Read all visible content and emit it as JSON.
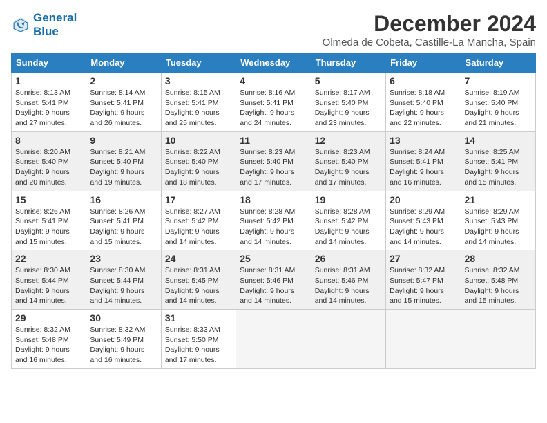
{
  "logo": {
    "line1": "General",
    "line2": "Blue"
  },
  "title": "December 2024",
  "subtitle": "Olmeda de Cobeta, Castille-La Mancha, Spain",
  "days_of_week": [
    "Sunday",
    "Monday",
    "Tuesday",
    "Wednesday",
    "Thursday",
    "Friday",
    "Saturday"
  ],
  "weeks": [
    [
      {
        "day": "1",
        "sunrise": "8:13 AM",
        "sunset": "5:41 PM",
        "daylight": "9 hours and 27 minutes."
      },
      {
        "day": "2",
        "sunrise": "8:14 AM",
        "sunset": "5:41 PM",
        "daylight": "9 hours and 26 minutes."
      },
      {
        "day": "3",
        "sunrise": "8:15 AM",
        "sunset": "5:41 PM",
        "daylight": "9 hours and 25 minutes."
      },
      {
        "day": "4",
        "sunrise": "8:16 AM",
        "sunset": "5:41 PM",
        "daylight": "9 hours and 24 minutes."
      },
      {
        "day": "5",
        "sunrise": "8:17 AM",
        "sunset": "5:40 PM",
        "daylight": "9 hours and 23 minutes."
      },
      {
        "day": "6",
        "sunrise": "8:18 AM",
        "sunset": "5:40 PM",
        "daylight": "9 hours and 22 minutes."
      },
      {
        "day": "7",
        "sunrise": "8:19 AM",
        "sunset": "5:40 PM",
        "daylight": "9 hours and 21 minutes."
      }
    ],
    [
      {
        "day": "8",
        "sunrise": "8:20 AM",
        "sunset": "5:40 PM",
        "daylight": "9 hours and 20 minutes."
      },
      {
        "day": "9",
        "sunrise": "8:21 AM",
        "sunset": "5:40 PM",
        "daylight": "9 hours and 19 minutes."
      },
      {
        "day": "10",
        "sunrise": "8:22 AM",
        "sunset": "5:40 PM",
        "daylight": "9 hours and 18 minutes."
      },
      {
        "day": "11",
        "sunrise": "8:23 AM",
        "sunset": "5:40 PM",
        "daylight": "9 hours and 17 minutes."
      },
      {
        "day": "12",
        "sunrise": "8:23 AM",
        "sunset": "5:40 PM",
        "daylight": "9 hours and 17 minutes."
      },
      {
        "day": "13",
        "sunrise": "8:24 AM",
        "sunset": "5:41 PM",
        "daylight": "9 hours and 16 minutes."
      },
      {
        "day": "14",
        "sunrise": "8:25 AM",
        "sunset": "5:41 PM",
        "daylight": "9 hours and 15 minutes."
      }
    ],
    [
      {
        "day": "15",
        "sunrise": "8:26 AM",
        "sunset": "5:41 PM",
        "daylight": "9 hours and 15 minutes."
      },
      {
        "day": "16",
        "sunrise": "8:26 AM",
        "sunset": "5:41 PM",
        "daylight": "9 hours and 15 minutes."
      },
      {
        "day": "17",
        "sunrise": "8:27 AM",
        "sunset": "5:42 PM",
        "daylight": "9 hours and 14 minutes."
      },
      {
        "day": "18",
        "sunrise": "8:28 AM",
        "sunset": "5:42 PM",
        "daylight": "9 hours and 14 minutes."
      },
      {
        "day": "19",
        "sunrise": "8:28 AM",
        "sunset": "5:42 PM",
        "daylight": "9 hours and 14 minutes."
      },
      {
        "day": "20",
        "sunrise": "8:29 AM",
        "sunset": "5:43 PM",
        "daylight": "9 hours and 14 minutes."
      },
      {
        "day": "21",
        "sunrise": "8:29 AM",
        "sunset": "5:43 PM",
        "daylight": "9 hours and 14 minutes."
      }
    ],
    [
      {
        "day": "22",
        "sunrise": "8:30 AM",
        "sunset": "5:44 PM",
        "daylight": "9 hours and 14 minutes."
      },
      {
        "day": "23",
        "sunrise": "8:30 AM",
        "sunset": "5:44 PM",
        "daylight": "9 hours and 14 minutes."
      },
      {
        "day": "24",
        "sunrise": "8:31 AM",
        "sunset": "5:45 PM",
        "daylight": "9 hours and 14 minutes."
      },
      {
        "day": "25",
        "sunrise": "8:31 AM",
        "sunset": "5:46 PM",
        "daylight": "9 hours and 14 minutes."
      },
      {
        "day": "26",
        "sunrise": "8:31 AM",
        "sunset": "5:46 PM",
        "daylight": "9 hours and 14 minutes."
      },
      {
        "day": "27",
        "sunrise": "8:32 AM",
        "sunset": "5:47 PM",
        "daylight": "9 hours and 15 minutes."
      },
      {
        "day": "28",
        "sunrise": "8:32 AM",
        "sunset": "5:48 PM",
        "daylight": "9 hours and 15 minutes."
      }
    ],
    [
      {
        "day": "29",
        "sunrise": "8:32 AM",
        "sunset": "5:48 PM",
        "daylight": "9 hours and 16 minutes."
      },
      {
        "day": "30",
        "sunrise": "8:32 AM",
        "sunset": "5:49 PM",
        "daylight": "9 hours and 16 minutes."
      },
      {
        "day": "31",
        "sunrise": "8:33 AM",
        "sunset": "5:50 PM",
        "daylight": "9 hours and 17 minutes."
      },
      null,
      null,
      null,
      null
    ]
  ]
}
